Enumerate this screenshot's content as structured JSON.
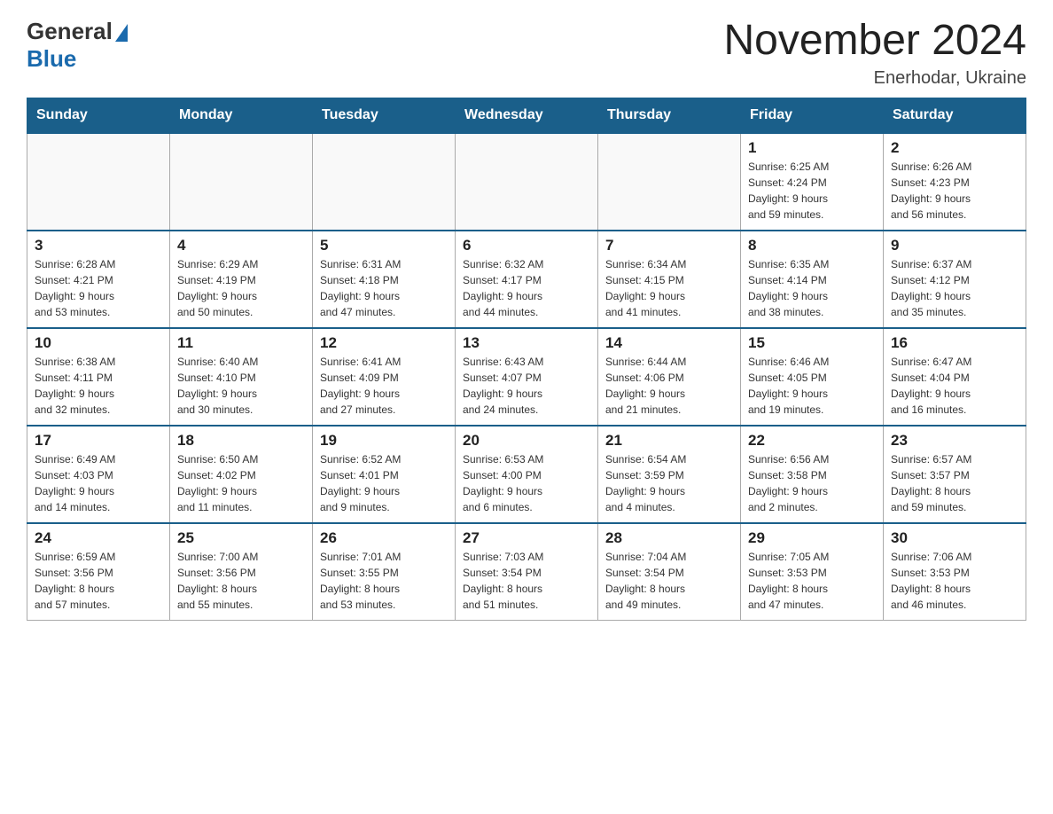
{
  "header": {
    "logo_general": "General",
    "logo_blue": "Blue",
    "month_title": "November 2024",
    "location": "Enerhodar, Ukraine"
  },
  "days_of_week": [
    "Sunday",
    "Monday",
    "Tuesday",
    "Wednesday",
    "Thursday",
    "Friday",
    "Saturday"
  ],
  "weeks": [
    [
      {
        "day": "",
        "info": ""
      },
      {
        "day": "",
        "info": ""
      },
      {
        "day": "",
        "info": ""
      },
      {
        "day": "",
        "info": ""
      },
      {
        "day": "",
        "info": ""
      },
      {
        "day": "1",
        "info": "Sunrise: 6:25 AM\nSunset: 4:24 PM\nDaylight: 9 hours\nand 59 minutes."
      },
      {
        "day": "2",
        "info": "Sunrise: 6:26 AM\nSunset: 4:23 PM\nDaylight: 9 hours\nand 56 minutes."
      }
    ],
    [
      {
        "day": "3",
        "info": "Sunrise: 6:28 AM\nSunset: 4:21 PM\nDaylight: 9 hours\nand 53 minutes."
      },
      {
        "day": "4",
        "info": "Sunrise: 6:29 AM\nSunset: 4:19 PM\nDaylight: 9 hours\nand 50 minutes."
      },
      {
        "day": "5",
        "info": "Sunrise: 6:31 AM\nSunset: 4:18 PM\nDaylight: 9 hours\nand 47 minutes."
      },
      {
        "day": "6",
        "info": "Sunrise: 6:32 AM\nSunset: 4:17 PM\nDaylight: 9 hours\nand 44 minutes."
      },
      {
        "day": "7",
        "info": "Sunrise: 6:34 AM\nSunset: 4:15 PM\nDaylight: 9 hours\nand 41 minutes."
      },
      {
        "day": "8",
        "info": "Sunrise: 6:35 AM\nSunset: 4:14 PM\nDaylight: 9 hours\nand 38 minutes."
      },
      {
        "day": "9",
        "info": "Sunrise: 6:37 AM\nSunset: 4:12 PM\nDaylight: 9 hours\nand 35 minutes."
      }
    ],
    [
      {
        "day": "10",
        "info": "Sunrise: 6:38 AM\nSunset: 4:11 PM\nDaylight: 9 hours\nand 32 minutes."
      },
      {
        "day": "11",
        "info": "Sunrise: 6:40 AM\nSunset: 4:10 PM\nDaylight: 9 hours\nand 30 minutes."
      },
      {
        "day": "12",
        "info": "Sunrise: 6:41 AM\nSunset: 4:09 PM\nDaylight: 9 hours\nand 27 minutes."
      },
      {
        "day": "13",
        "info": "Sunrise: 6:43 AM\nSunset: 4:07 PM\nDaylight: 9 hours\nand 24 minutes."
      },
      {
        "day": "14",
        "info": "Sunrise: 6:44 AM\nSunset: 4:06 PM\nDaylight: 9 hours\nand 21 minutes."
      },
      {
        "day": "15",
        "info": "Sunrise: 6:46 AM\nSunset: 4:05 PM\nDaylight: 9 hours\nand 19 minutes."
      },
      {
        "day": "16",
        "info": "Sunrise: 6:47 AM\nSunset: 4:04 PM\nDaylight: 9 hours\nand 16 minutes."
      }
    ],
    [
      {
        "day": "17",
        "info": "Sunrise: 6:49 AM\nSunset: 4:03 PM\nDaylight: 9 hours\nand 14 minutes."
      },
      {
        "day": "18",
        "info": "Sunrise: 6:50 AM\nSunset: 4:02 PM\nDaylight: 9 hours\nand 11 minutes."
      },
      {
        "day": "19",
        "info": "Sunrise: 6:52 AM\nSunset: 4:01 PM\nDaylight: 9 hours\nand 9 minutes."
      },
      {
        "day": "20",
        "info": "Sunrise: 6:53 AM\nSunset: 4:00 PM\nDaylight: 9 hours\nand 6 minutes."
      },
      {
        "day": "21",
        "info": "Sunrise: 6:54 AM\nSunset: 3:59 PM\nDaylight: 9 hours\nand 4 minutes."
      },
      {
        "day": "22",
        "info": "Sunrise: 6:56 AM\nSunset: 3:58 PM\nDaylight: 9 hours\nand 2 minutes."
      },
      {
        "day": "23",
        "info": "Sunrise: 6:57 AM\nSunset: 3:57 PM\nDaylight: 8 hours\nand 59 minutes."
      }
    ],
    [
      {
        "day": "24",
        "info": "Sunrise: 6:59 AM\nSunset: 3:56 PM\nDaylight: 8 hours\nand 57 minutes."
      },
      {
        "day": "25",
        "info": "Sunrise: 7:00 AM\nSunset: 3:56 PM\nDaylight: 8 hours\nand 55 minutes."
      },
      {
        "day": "26",
        "info": "Sunrise: 7:01 AM\nSunset: 3:55 PM\nDaylight: 8 hours\nand 53 minutes."
      },
      {
        "day": "27",
        "info": "Sunrise: 7:03 AM\nSunset: 3:54 PM\nDaylight: 8 hours\nand 51 minutes."
      },
      {
        "day": "28",
        "info": "Sunrise: 7:04 AM\nSunset: 3:54 PM\nDaylight: 8 hours\nand 49 minutes."
      },
      {
        "day": "29",
        "info": "Sunrise: 7:05 AM\nSunset: 3:53 PM\nDaylight: 8 hours\nand 47 minutes."
      },
      {
        "day": "30",
        "info": "Sunrise: 7:06 AM\nSunset: 3:53 PM\nDaylight: 8 hours\nand 46 minutes."
      }
    ]
  ]
}
